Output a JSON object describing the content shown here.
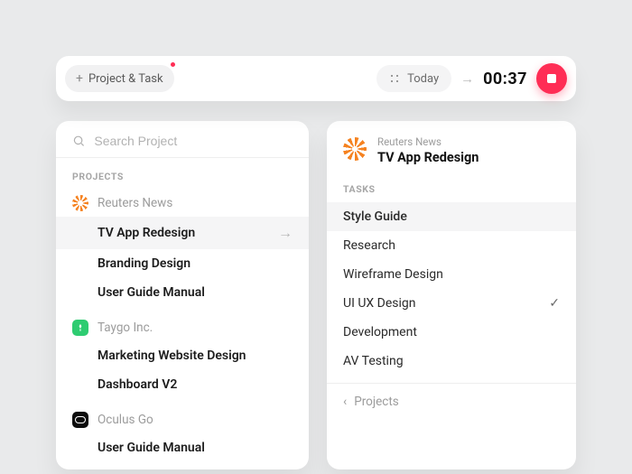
{
  "colors": {
    "accent": "#ff2d55",
    "taygo": "#2ecc71"
  },
  "topbar": {
    "add_label": "Project & Task",
    "today_label": "Today",
    "timer": "00:37"
  },
  "left": {
    "search_placeholder": "Search Project",
    "section_label": "PROJECTS",
    "groups": [
      {
        "name": "Reuters News",
        "icon": "reuters",
        "projects": [
          {
            "name": "TV App Redesign",
            "active": true
          },
          {
            "name": "Branding Design"
          },
          {
            "name": "User Guide Manual"
          }
        ]
      },
      {
        "name": "Taygo Inc.",
        "icon": "taygo",
        "projects": [
          {
            "name": "Marketing Website Design"
          },
          {
            "name": "Dashboard V2"
          }
        ]
      },
      {
        "name": "Oculus Go",
        "icon": "oculus",
        "projects": [
          {
            "name": "User Guide Manual"
          }
        ]
      }
    ]
  },
  "right": {
    "breadcrumb_parent": "Reuters News",
    "title": "TV App Redesign",
    "section_label": "TASKS",
    "tasks": [
      {
        "name": "Style Guide",
        "active": true
      },
      {
        "name": "Research"
      },
      {
        "name": "Wireframe Design"
      },
      {
        "name": "UI UX Design",
        "checked": true
      },
      {
        "name": "Development"
      },
      {
        "name": "AV Testing"
      }
    ],
    "footer_label": "Projects"
  }
}
